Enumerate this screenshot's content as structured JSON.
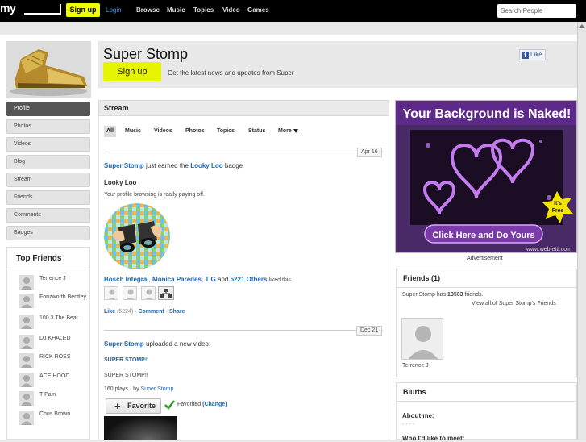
{
  "topbar": {
    "logo": "my",
    "signup_label": "Sign up",
    "login_label": "Login",
    "nav": [
      "Browse",
      "Music",
      "Topics",
      "Video",
      "Games"
    ],
    "search_placeholder": "Search People"
  },
  "header": {
    "name": "Super Stomp",
    "signup_label": "Sign up",
    "tagline": "Get the latest news and updates from Super",
    "like_label": "Like",
    "fb_letter": "f"
  },
  "left_nav": [
    "Profile",
    "Photos",
    "Videos",
    "Blog",
    "Stream",
    "Friends",
    "Comments",
    "Badges"
  ],
  "top_friends": {
    "title": "Top Friends",
    "items": [
      "Terrence J",
      "Fonzworth Bentley",
      "100.3 The Beat",
      "DJ KHALED",
      "RICK ROSS",
      "ACE HOOD",
      "T Pain",
      "Chris Brown"
    ]
  },
  "stream": {
    "title": "Stream",
    "tabs": [
      "All",
      "Music",
      "Videos",
      "Photos",
      "Topics",
      "Status",
      "More"
    ],
    "entry1": {
      "date": "Apr 16",
      "actor": "Super Stomp",
      "verb_pre": "just earned the",
      "badge_link": "Looky Loo",
      "verb_post": "badge",
      "badge_title": "Looky Loo",
      "badge_desc": "Your profile browsing is really paying off.",
      "likers_1": "Bosch Integral",
      "likers_sep1": ",",
      "likers_2": "Mònica Paredes",
      "likers_sep2": ",",
      "likers_3": "T G",
      "likers_and": "and",
      "likers_others": "5221 Others",
      "likers_suffix": "liked this.",
      "like_label": "Like",
      "like_count": "(5224)",
      "comment_label": "Comment",
      "share_label": "Share",
      "dot": "·"
    },
    "entry2": {
      "date": "Dec 21",
      "actor": "Super Stomp",
      "verb": "uploaded a new video:",
      "video_title": "SUPER STOMP!!",
      "video_desc": "SUPER STOMP!!",
      "plays": "160 plays · by",
      "by": "Super Stomp",
      "favorite_label": "Favorite",
      "favorited_label": "Favorited",
      "change_label": "(Change)"
    }
  },
  "ad": {
    "headline": "Your Background is Naked!",
    "cta": "Click Here and Do Yours",
    "burst_line1": "It's",
    "burst_line2": "Free",
    "site": "www.webfetti.com",
    "caption": "Advertisement"
  },
  "friends_panel": {
    "title": "Friends (1)",
    "summary_pre": "Super Stomp has",
    "summary_count": "13563",
    "summary_post": "friends.",
    "view_all": "View all of Super Stomp's Friends",
    "friend_name": "Terrence J"
  },
  "blurbs": {
    "title": "Blurbs",
    "about_label": "About me:",
    "about_value": "- - - -",
    "who_label": "Who I'd like to meet:"
  },
  "colors": {
    "accent_yellow": "#e6f400",
    "link_blue": "#1a66b3"
  }
}
